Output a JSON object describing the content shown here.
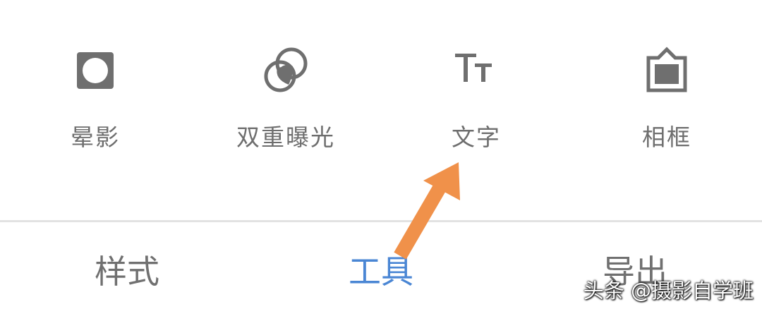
{
  "tools": [
    {
      "label": "晕影",
      "icon": "vignette-icon"
    },
    {
      "label": "双重曝光",
      "icon": "double-exposure-icon"
    },
    {
      "label": "文字",
      "icon": "text-icon"
    },
    {
      "label": "相框",
      "icon": "frame-icon"
    }
  ],
  "tabs": [
    {
      "label": "样式",
      "active": false
    },
    {
      "label": "工具",
      "active": true
    },
    {
      "label": "导出",
      "active": false
    }
  ],
  "colors": {
    "icon": "#6f6f6f",
    "label": "#6e6e6e",
    "active_tab": "#4a86d4",
    "arrow": "#f0914a"
  },
  "watermark": "头条 @摄影自学班"
}
